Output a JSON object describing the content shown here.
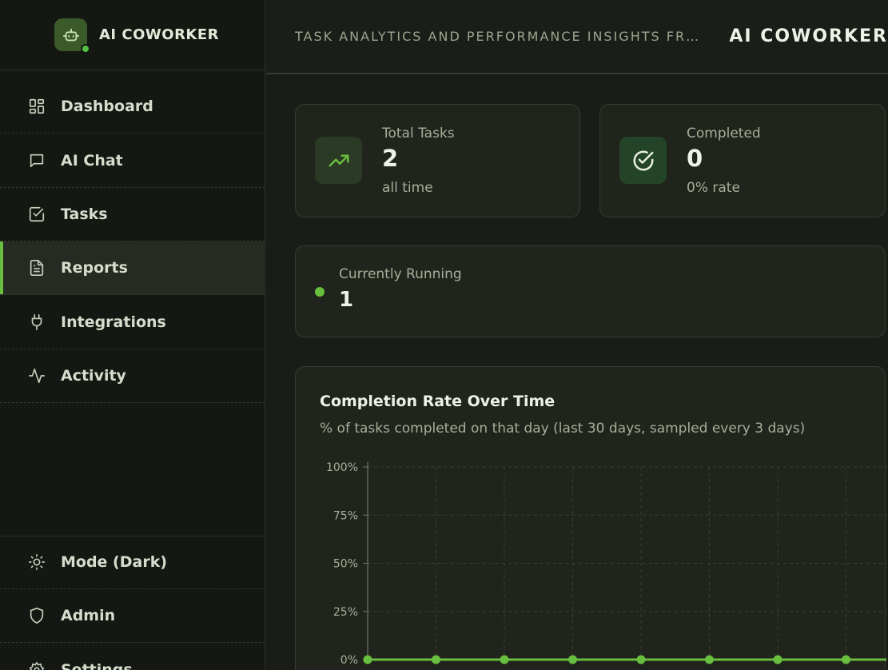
{
  "brand": {
    "name": "AI COWORKER"
  },
  "header": {
    "subtitle": "TASK ANALYTICS AND PERFORMANCE INSIGHTS FROM YOUR AI COWORKER",
    "title": "AI COWORKER"
  },
  "sidebar": {
    "items": [
      {
        "label": "Dashboard",
        "icon": "dashboard-grid-icon"
      },
      {
        "label": "AI Chat",
        "icon": "chat-bubble-icon"
      },
      {
        "label": "Tasks",
        "icon": "checkbox-icon"
      },
      {
        "label": "Reports",
        "icon": "document-icon",
        "active": true
      },
      {
        "label": "Integrations",
        "icon": "plug-icon"
      },
      {
        "label": "Activity",
        "icon": "activity-pulse-icon"
      }
    ],
    "bottom_items": [
      {
        "label": "Mode (Dark)",
        "icon": "sun-icon"
      },
      {
        "label": "Admin",
        "icon": "shield-icon"
      },
      {
        "label": "Settings",
        "icon": "gear-icon"
      }
    ]
  },
  "stats": {
    "total_tasks": {
      "label": "Total Tasks",
      "value": "2",
      "sub": "all time",
      "icon": "trending-up-icon"
    },
    "completed": {
      "label": "Completed",
      "value": "0",
      "sub": "0% rate",
      "icon": "check-circle-icon"
    },
    "running": {
      "label": "Currently Running",
      "value": "1"
    }
  },
  "colors": {
    "accent": "#6abe3f",
    "status_online": "#52c142",
    "background": "#1a1d17",
    "card": "#20241d"
  },
  "chart_data": {
    "type": "line",
    "title": "Completion Rate Over Time",
    "subtitle": "% of tasks completed on that day (last 30 days, sampled every 3 days)",
    "y_tick_labels": [
      "100%",
      "75%",
      "50%",
      "25%",
      "0%"
    ],
    "ylim": [
      0,
      100
    ],
    "grid": true,
    "series": [
      {
        "values": [
          0,
          0,
          0,
          0,
          0,
          0,
          0,
          0,
          0,
          0,
          0
        ]
      }
    ]
  }
}
